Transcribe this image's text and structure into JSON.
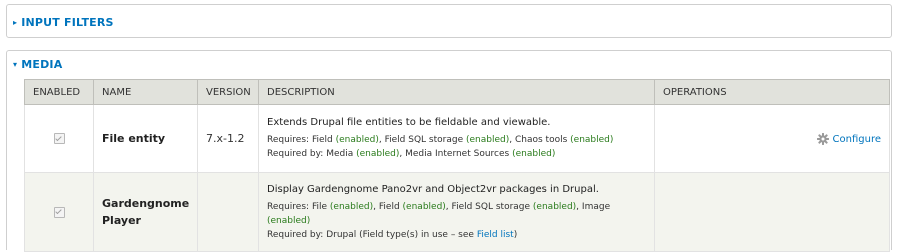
{
  "sections": {
    "input_filters": {
      "title": "INPUT FILTERS"
    },
    "media": {
      "title": "MEDIA"
    }
  },
  "table": {
    "headers": {
      "enabled": "ENABLED",
      "name": "NAME",
      "version": "VERSION",
      "description": "DESCRIPTION",
      "operations": "OPERATIONS"
    },
    "rows": [
      {
        "name": "File entity",
        "version": "7.x-1.2",
        "description": "Extends Drupal file entities to be fieldable and viewable.",
        "requires_label": "Requires:",
        "requires": [
          {
            "name": "Field",
            "status": "(enabled)",
            "sep": ","
          },
          {
            "name": "Field SQL storage",
            "status": "(enabled)",
            "sep": ","
          },
          {
            "name": "Chaos tools",
            "status": "(enabled)",
            "sep": ""
          }
        ],
        "required_by_label": "Required by:",
        "required_by": [
          {
            "name": "Media",
            "status": "(enabled)",
            "sep": ","
          },
          {
            "name": "Media Internet Sources",
            "status": "(enabled)",
            "sep": ""
          }
        ],
        "operation": "Configure",
        "operation_icon": "gear-icon"
      },
      {
        "name": "Gardengnome Player",
        "version": "",
        "description": "Display Gardengnome Pano2vr and Object2vr packages in Drupal.",
        "requires_label": "Requires:",
        "requires": [
          {
            "name": "File",
            "status": "(enabled)",
            "sep": ","
          },
          {
            "name": "Field",
            "status": "(enabled)",
            "sep": ","
          },
          {
            "name": "Field SQL storage",
            "status": "(enabled)",
            "sep": ","
          },
          {
            "name": "Image",
            "status": "(enabled)",
            "sep": ""
          }
        ],
        "required_by_label": "Required by:",
        "required_by_text": "Drupal (Field type(s) in use – see",
        "required_by_link": "Field list",
        "required_by_close": ")"
      }
    ]
  },
  "colors": {
    "link": "#0074bd",
    "enabled": "#2a7b1c",
    "header_bg": "#e1e2dc",
    "row_alt_bg": "#f3f4ee"
  }
}
